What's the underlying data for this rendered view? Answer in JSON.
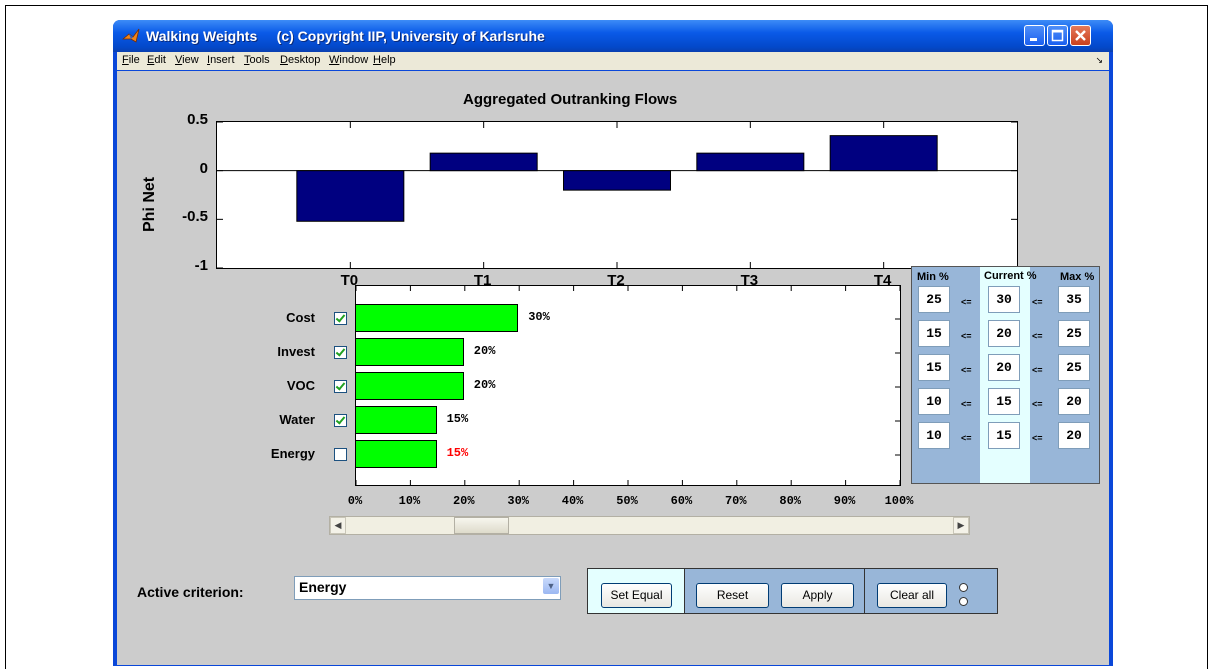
{
  "window": {
    "title": "Walking Weights     (c) Copyright IIP, University of Karlsruhe",
    "controls": [
      "minimize-icon",
      "maximize-icon",
      "close-icon"
    ]
  },
  "menu": {
    "items": [
      "File",
      "Edit",
      "View",
      "Insert",
      "Tools",
      "Desktop",
      "Window",
      "Help"
    ],
    "dock_icon": "dock-arrow-icon"
  },
  "chart_data": {
    "type": "bar",
    "title": "Aggregated Outranking Flows",
    "ylabel": "Phi Net",
    "xlabel": "",
    "categories": [
      "T0",
      "T1",
      "T2",
      "T3",
      "T4"
    ],
    "values": [
      -0.52,
      0.18,
      -0.2,
      0.18,
      0.36
    ],
    "ylim": [
      -1,
      0.5
    ],
    "yticks": [
      "0.5",
      "0",
      "-0.5",
      "-1"
    ],
    "bar_color": "#000080"
  },
  "criteria": {
    "items": [
      {
        "label": "Cost",
        "checked": true,
        "weight": 30,
        "weight_text": "30%",
        "min": "25",
        "current": "30",
        "max": "35"
      },
      {
        "label": "Invest",
        "checked": true,
        "weight": 20,
        "weight_text": "20%",
        "min": "15",
        "current": "20",
        "max": "25"
      },
      {
        "label": "VOC",
        "checked": true,
        "weight": 20,
        "weight_text": "20%",
        "min": "15",
        "current": "20",
        "max": "25"
      },
      {
        "label": "Water",
        "checked": true,
        "weight": 15,
        "weight_text": "15%",
        "min": "10",
        "current": "15",
        "max": "20"
      },
      {
        "label": "Energy",
        "checked": false,
        "weight": 15,
        "weight_text": "15%",
        "min": "10",
        "current": "15",
        "max": "20",
        "highlight_color": "#ff0000"
      }
    ],
    "percent_ticks": [
      "0%",
      "10%",
      "20%",
      "30%",
      "40%",
      "50%",
      "60%",
      "70%",
      "80%",
      "90%",
      "100%"
    ],
    "bar_color": "#00ff00",
    "slider_value": 15
  },
  "limits_panel": {
    "min_header": "Min %",
    "current_header": "Current %",
    "max_header": "Max %",
    "operator": "<="
  },
  "bottom": {
    "active_label": "Active criterion:",
    "active_value": "Energy",
    "buttons": {
      "set_equal": "Set Equal",
      "reset": "Reset",
      "apply": "Apply",
      "clear_all": "Clear all"
    }
  }
}
